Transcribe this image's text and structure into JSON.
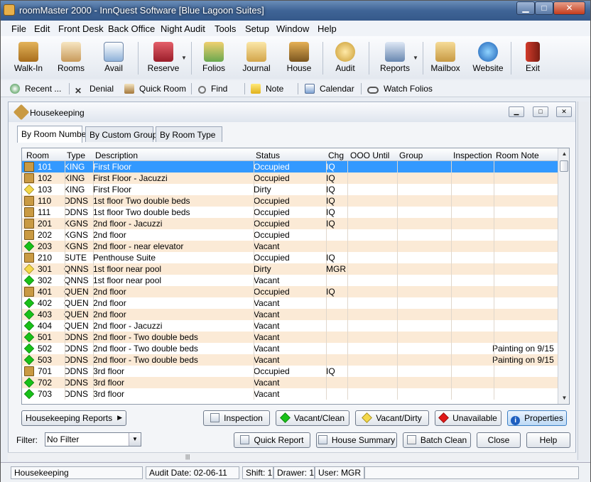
{
  "window": {
    "title": "roomMaster 2000 - InnQuest Software [Blue Lagoon Suites]",
    "controls": {
      "min": "▁",
      "max": "□",
      "close": "✕"
    }
  },
  "menu": [
    "File",
    "Edit",
    "Front Desk",
    "Back Office",
    "Night Audit",
    "Tools",
    "Setup",
    "Window",
    "Help"
  ],
  "toolbar": {
    "walkin": "Walk-In",
    "rooms": "Rooms",
    "avail": "Avail",
    "reserve": "Reserve",
    "folios": "Folios",
    "journal": "Journal",
    "house": "House",
    "audit": "Audit",
    "reports": "Reports",
    "mailbox": "Mailbox",
    "website": "Website",
    "exit": "Exit"
  },
  "toolbar2": {
    "recent": "Recent ...",
    "denial": "Denial",
    "quickroom": "Quick Room",
    "find": "Find",
    "note": "Note",
    "calendar": "Calendar",
    "watch": "Watch Folios"
  },
  "panel": {
    "title": "Housekeeping"
  },
  "tabs": [
    "By Room Number",
    "By Custom Group",
    "By Room Type"
  ],
  "columns": [
    "Room",
    "Type",
    "Description",
    "Status",
    "Chg",
    "OOO Until",
    "Group",
    "Inspection",
    "Room Note"
  ],
  "rows": [
    {
      "room": "101",
      "type": "KING",
      "desc": "First Floor",
      "status": "Occupied",
      "chg": "IQ",
      "note": "",
      "icon": "occupied"
    },
    {
      "room": "102",
      "type": "KING",
      "desc": "First Floor - Jacuzzi",
      "status": "Occupied",
      "chg": "IQ",
      "note": "",
      "icon": "occupied"
    },
    {
      "room": "103",
      "type": "KING",
      "desc": "First Floor",
      "status": "Dirty",
      "chg": "IQ",
      "note": "",
      "icon": "dirty"
    },
    {
      "room": "110",
      "type": "DDNS",
      "desc": "1st floor Two double beds",
      "status": "Occupied",
      "chg": "IQ",
      "note": "",
      "icon": "occupied"
    },
    {
      "room": "111",
      "type": "DDNS",
      "desc": "1st floor Two double beds",
      "status": "Occupied",
      "chg": "IQ",
      "note": "",
      "icon": "occupied"
    },
    {
      "room": "201",
      "type": "KGNS",
      "desc": "2nd floor - Jacuzzi",
      "status": "Occupied",
      "chg": "IQ",
      "note": "",
      "icon": "occupied"
    },
    {
      "room": "202",
      "type": "KGNS",
      "desc": "2nd floor",
      "status": "Occupied",
      "chg": "",
      "note": "",
      "icon": "occupied"
    },
    {
      "room": "203",
      "type": "KGNS",
      "desc": "2nd floor - near elevator",
      "status": "Vacant",
      "chg": "",
      "note": "",
      "icon": "vacant"
    },
    {
      "room": "210",
      "type": "SUTE",
      "desc": "Penthouse Suite",
      "status": "Occupied",
      "chg": "IQ",
      "note": "",
      "icon": "occupied"
    },
    {
      "room": "301",
      "type": "QNNS",
      "desc": "1st floor near pool",
      "status": "Dirty",
      "chg": "MGR",
      "note": "",
      "icon": "dirty"
    },
    {
      "room": "302",
      "type": "QNNS",
      "desc": "1st floor near pool",
      "status": "Vacant",
      "chg": "",
      "note": "",
      "icon": "vacant"
    },
    {
      "room": "401",
      "type": "QUEN",
      "desc": "2nd floor",
      "status": "Occupied",
      "chg": "IQ",
      "note": "",
      "icon": "occupied"
    },
    {
      "room": "402",
      "type": "QUEN",
      "desc": "2nd floor",
      "status": "Vacant",
      "chg": "",
      "note": "",
      "icon": "vacant"
    },
    {
      "room": "403",
      "type": "QUEN",
      "desc": "2nd floor",
      "status": "Vacant",
      "chg": "",
      "note": "",
      "icon": "vacant"
    },
    {
      "room": "404",
      "type": "QUEN",
      "desc": "2nd floor - Jacuzzi",
      "status": "Vacant",
      "chg": "",
      "note": "",
      "icon": "vacant"
    },
    {
      "room": "501",
      "type": "DDNS",
      "desc": "2nd floor - Two double beds",
      "status": "Vacant",
      "chg": "",
      "note": "",
      "icon": "vacant"
    },
    {
      "room": "502",
      "type": "DDNS",
      "desc": "2nd floor - Two double beds",
      "status": "Vacant",
      "chg": "",
      "note": "Painting on 9/15",
      "icon": "vacant"
    },
    {
      "room": "503",
      "type": "DDNS",
      "desc": "2nd floor - Two double beds",
      "status": "Vacant",
      "chg": "",
      "note": "Painting on 9/15",
      "icon": "vacant"
    },
    {
      "room": "701",
      "type": "DDNS",
      "desc": "3rd floor",
      "status": "Occupied",
      "chg": "IQ",
      "note": "",
      "icon": "occupied"
    },
    {
      "room": "702",
      "type": "DDNS",
      "desc": "3rd floor",
      "status": "Vacant",
      "chg": "",
      "note": "",
      "icon": "vacant"
    },
    {
      "room": "703",
      "type": "DDNS",
      "desc": "3rd floor",
      "status": "Vacant",
      "chg": "",
      "note": "",
      "icon": "vacant"
    }
  ],
  "buttons": {
    "hk_reports": "Housekeeping Reports",
    "inspection": "Inspection",
    "vacant_clean": "Vacant/Clean",
    "vacant_dirty": "Vacant/Dirty",
    "unavailable": "Unavailable",
    "properties": "Properties",
    "quick_report": "Quick Report",
    "house_summary": "House Summary",
    "batch_clean": "Batch Clean",
    "close": "Close",
    "help": "Help"
  },
  "filter": {
    "label": "Filter:",
    "value": "No Filter"
  },
  "status": {
    "module": "Housekeeping",
    "audit": "Audit Date: 02-06-11",
    "shift": "Shift: 1",
    "drawer": "Drawer: 1",
    "user": "User: MGR"
  },
  "colors": {
    "selection": "#3399ff",
    "alt_row": "#fbead6",
    "vacant": "#19c119",
    "dirty": "#f4d84a",
    "occupied": "#c99a43",
    "unavailable": "#e01818"
  }
}
